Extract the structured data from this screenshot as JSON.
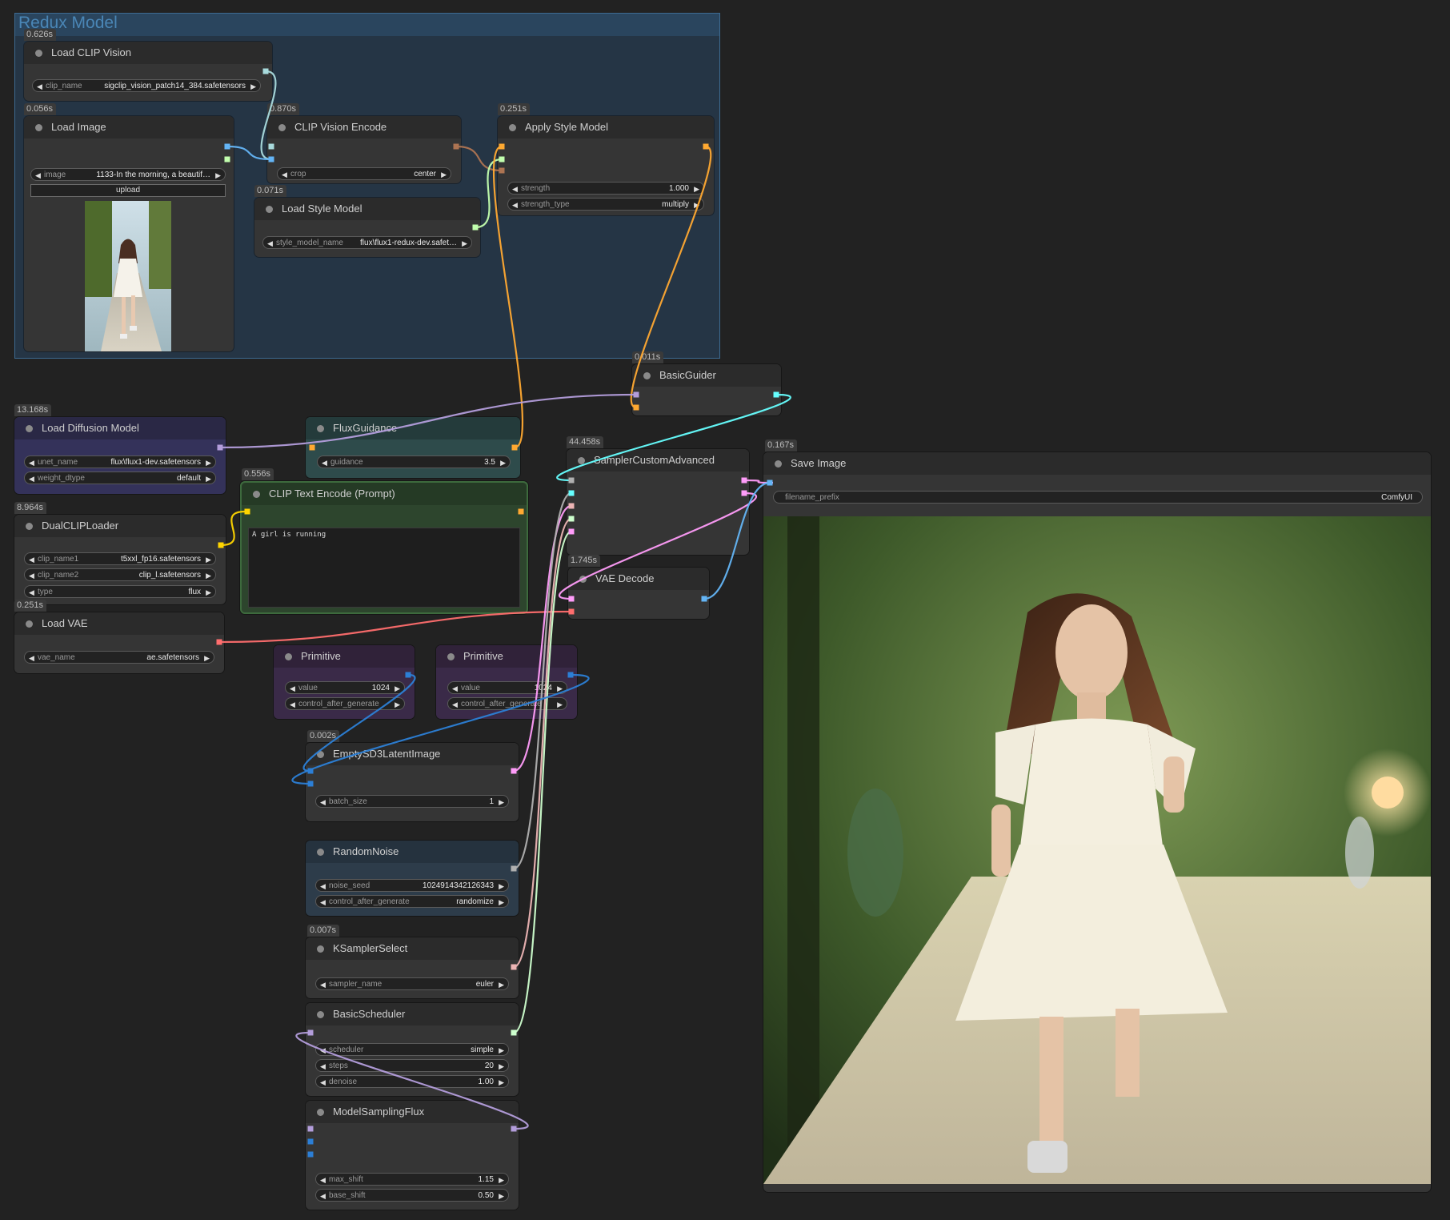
{
  "group": {
    "title": "Redux Model"
  },
  "nodes": {
    "load_clip_vision": {
      "time": "0.626s",
      "title": "Load CLIP Vision",
      "widgets": [
        {
          "label": "clip_name",
          "value": "sigclip_vision_patch14_384.safetensors"
        }
      ]
    },
    "load_image": {
      "time": "0.056s",
      "title": "Load Image",
      "widgets": [
        {
          "label": "image",
          "value": "1133-In the morning, a beautif…"
        }
      ],
      "upload_label": "upload"
    },
    "clip_vision_encode": {
      "time": "0.870s",
      "title": "CLIP Vision Encode",
      "widgets": [
        {
          "label": "crop",
          "value": "center"
        }
      ]
    },
    "load_style_model": {
      "time": "0.071s",
      "title": "Load Style Model",
      "widgets": [
        {
          "label": "style_model_name",
          "value": "flux\\flux1-redux-dev.safet…"
        }
      ]
    },
    "apply_style_model": {
      "time": "0.251s",
      "title": "Apply Style Model",
      "widgets": [
        {
          "label": "strength",
          "value": "1.000"
        },
        {
          "label": "strength_type",
          "value": "multiply"
        }
      ]
    },
    "basic_guider": {
      "time": "0.011s",
      "title": "BasicGuider"
    },
    "load_diffusion_model": {
      "time": "13.168s",
      "title": "Load Diffusion Model",
      "widgets": [
        {
          "label": "unet_name",
          "value": "flux\\flux1-dev.safetensors"
        },
        {
          "label": "weight_dtype",
          "value": "default"
        }
      ]
    },
    "flux_guidance": {
      "title": "FluxGuidance",
      "widgets": [
        {
          "label": "guidance",
          "value": "3.5"
        }
      ]
    },
    "clip_text_encode": {
      "time": "0.556s",
      "title": "CLIP Text Encode (Prompt)",
      "text": "A girl is running"
    },
    "sampler_custom_advanced": {
      "time": "44.458s",
      "title": "SamplerCustomAdvanced"
    },
    "save_image": {
      "time": "0.167s",
      "title": "Save Image",
      "widgets": [
        {
          "label": "filename_prefix",
          "value": "ComfyUI"
        }
      ]
    },
    "dual_clip_loader": {
      "time": "8.964s",
      "title": "DualCLIPLoader",
      "widgets": [
        {
          "label": "clip_name1",
          "value": "t5xxl_fp16.safetensors"
        },
        {
          "label": "clip_name2",
          "value": "clip_l.safetensors"
        },
        {
          "label": "type",
          "value": "flux"
        }
      ]
    },
    "load_vae": {
      "time": "0.251s",
      "title": "Load VAE",
      "widgets": [
        {
          "label": "vae_name",
          "value": "ae.safetensors"
        }
      ]
    },
    "vae_decode": {
      "time": "1.745s",
      "title": "VAE Decode"
    },
    "primitive_1": {
      "title": "Primitive",
      "widgets": [
        {
          "label": "value",
          "value": "1024"
        },
        {
          "label": "control_after_generate",
          "value": ""
        }
      ]
    },
    "primitive_2": {
      "title": "Primitive",
      "widgets": [
        {
          "label": "value",
          "value": "1024"
        },
        {
          "label": "control_after_generate",
          "value": ""
        }
      ]
    },
    "empty_latent": {
      "time": "0.002s",
      "title": "EmptySD3LatentImage",
      "widgets": [
        {
          "label": "batch_size",
          "value": "1"
        }
      ]
    },
    "random_noise": {
      "title": "RandomNoise",
      "widgets": [
        {
          "label": "noise_seed",
          "value": "1024914342126343"
        },
        {
          "label": "control_after_generate",
          "value": "randomize"
        }
      ]
    },
    "ksampler_select": {
      "time": "0.007s",
      "title": "KSamplerSelect",
      "widgets": [
        {
          "label": "sampler_name",
          "value": "euler"
        }
      ]
    },
    "basic_scheduler": {
      "title": "BasicScheduler",
      "widgets": [
        {
          "label": "scheduler",
          "value": "simple"
        },
        {
          "label": "steps",
          "value": "20"
        },
        {
          "label": "denoise",
          "value": "1.00"
        }
      ]
    },
    "model_sampling_flux": {
      "title": "ModelSamplingFlux",
      "widgets": [
        {
          "label": "max_shift",
          "value": "1.15"
        },
        {
          "label": "base_shift",
          "value": "0.50"
        }
      ]
    }
  },
  "colors": {
    "clip_vision": "#a8dadc",
    "image": "#64b5f6",
    "conditioning": "#ffa931",
    "model": "#b39ddb",
    "clip": "#ffd500",
    "vae": "#ff6e6e",
    "latent": "#ff9cf9",
    "int": "#2c7fd6",
    "noise": "#b0b0b0",
    "sigmas": "#cdffcd",
    "sampler": "#ecb4b4",
    "guider": "#66ffff",
    "style_model": "#c2ffae",
    "clip_vision_output": "#ad7452"
  }
}
